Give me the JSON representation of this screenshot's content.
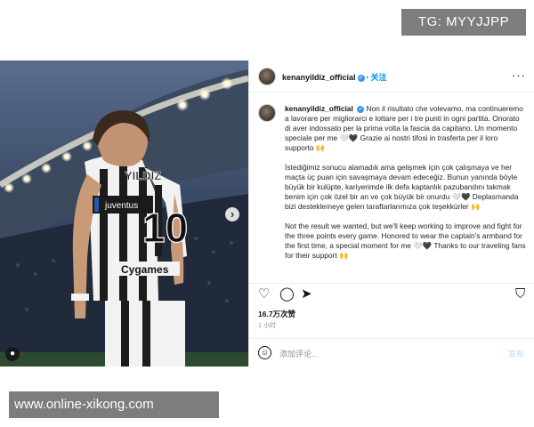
{
  "watermark_top": "TG: MYYJJPP",
  "watermark_bottom": "www.online-xikong.com",
  "post": {
    "username": "kenanyildiz_official",
    "verified_icon": "verified-badge-icon",
    "follow_label": "关注",
    "more_label": "···",
    "jersey": {
      "name": "YILDIZ",
      "number": "10",
      "armband_text": "juventus",
      "sponsor": "Cygames"
    },
    "caption_username": "kenanyildiz_official",
    "caption_paragraphs": [
      "Non il risultato che volevamo, ma continueremo a lavorare per migliorarci e lottare per i tre punti in ogni partita. Onorato di aver indossato per la prima volta la fascia da capitano. Un momento speciale per me 🤍🖤 Grazie ai nostri tifosi in trasferta per il loro supporto 🙌",
      "İstediğimiz sonucu alamadık ama gelişmek için çok çalışmaya ve her maçta üç puan için savaşmaya devam edeceğiz. Bunun yanında böyle büyük bir kulüpte, kariyerimde ilk defa kaptanlık pazubandını takmak benim için çok özel bir an ve çok büyük bir onurdu 🤍🖤 Deplasmanda bizi desteklemeye gelen taraftarlarımıza çok teşekkürler 🙌",
      "Not the result we wanted, but we'll keep working to improve and fight for the three points every game. Honored to wear the captain's armband for the first time, a special moment for me 🤍🖤 Thanks to our traveling fans for their support 🙌"
    ],
    "likes": "16.7万次赞",
    "time_ago": "1 小时",
    "comment_placeholder": "添加评论...",
    "post_label": "发布"
  }
}
